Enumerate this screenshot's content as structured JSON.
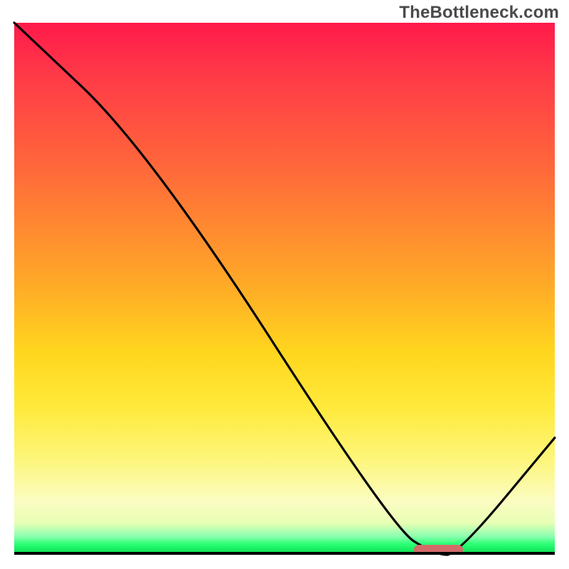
{
  "watermark": "TheBottleneck.com",
  "chart_data": {
    "type": "line",
    "title": "",
    "xlabel": "",
    "ylabel": "",
    "xlim": [
      0,
      100
    ],
    "ylim": [
      0,
      100
    ],
    "grid": false,
    "series": [
      {
        "name": "bottleneck-curve",
        "x": [
          0,
          25,
          70,
          78,
          82,
          100
        ],
        "values": [
          100,
          76,
          5,
          0,
          0,
          22
        ]
      }
    ],
    "annotations": [
      {
        "name": "valley-marker",
        "kind": "pill",
        "x_range": [
          74,
          83
        ],
        "y": 1,
        "color": "#d46a6a"
      }
    ],
    "background": {
      "kind": "vertical-gradient",
      "stops": [
        {
          "pos": 0,
          "color": "#ff1a4b"
        },
        {
          "pos": 0.28,
          "color": "#ff6a3a"
        },
        {
          "pos": 0.62,
          "color": "#ffd61e"
        },
        {
          "pos": 0.9,
          "color": "#fbfcc2"
        },
        {
          "pos": 1.0,
          "color": "#07d84e"
        }
      ]
    }
  }
}
